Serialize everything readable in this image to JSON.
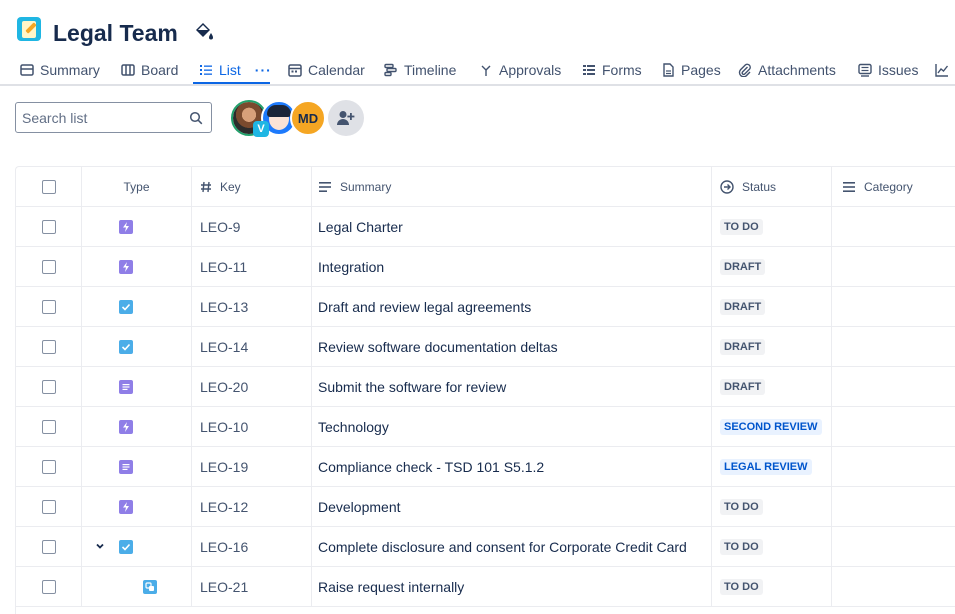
{
  "project": {
    "title": "Legal Team",
    "icon": "notepad-pencil-icon"
  },
  "tabs": [
    {
      "label": "Summary",
      "icon": "summary-icon"
    },
    {
      "label": "Board",
      "icon": "board-icon"
    },
    {
      "label": "List",
      "icon": "list-icon",
      "active": true
    },
    {
      "label": "Calendar",
      "icon": "calendar-icon"
    },
    {
      "label": "Timeline",
      "icon": "timeline-icon"
    },
    {
      "label": "Approvals",
      "icon": "approvals-icon"
    },
    {
      "label": "Forms",
      "icon": "forms-icon"
    },
    {
      "label": "Pages",
      "icon": "pages-icon"
    },
    {
      "label": "Attachments",
      "icon": "attachment-icon"
    },
    {
      "label": "Issues",
      "icon": "issues-icon"
    }
  ],
  "search": {
    "placeholder": "Search list"
  },
  "avatars": [
    {
      "initials": "",
      "badge": "V"
    },
    {
      "initials": ""
    },
    {
      "initials": "MD"
    }
  ],
  "columns": {
    "type": "Type",
    "key": "Key",
    "summary": "Summary",
    "status": "Status",
    "category": "Category"
  },
  "rows": [
    {
      "type": "epic",
      "key": "LEO-9",
      "summary": "Legal Charter",
      "status": "TO DO",
      "status_color": "grey"
    },
    {
      "type": "epic",
      "key": "LEO-11",
      "summary": "Integration",
      "status": "DRAFT",
      "status_color": "grey"
    },
    {
      "type": "task",
      "key": "LEO-13",
      "summary": "Draft and review legal agreements",
      "status": "DRAFT",
      "status_color": "grey"
    },
    {
      "type": "task",
      "key": "LEO-14",
      "summary": "Review software documentation deltas",
      "status": "DRAFT",
      "status_color": "grey"
    },
    {
      "type": "story",
      "key": "LEO-20",
      "summary": "Submit the software for review",
      "status": "DRAFT",
      "status_color": "grey"
    },
    {
      "type": "epic",
      "key": "LEO-10",
      "summary": "Technology",
      "status": "SECOND REVIEW",
      "status_color": "blue"
    },
    {
      "type": "story",
      "key": "LEO-19",
      "summary": "Compliance check - TSD 101 S5.1.2",
      "status": "LEGAL REVIEW",
      "status_color": "blue"
    },
    {
      "type": "epic",
      "key": "LEO-12",
      "summary": "Development",
      "status": "TO DO",
      "status_color": "grey"
    },
    {
      "type": "task",
      "key": "LEO-16",
      "summary": "Complete disclosure and consent for Corporate Credit Card",
      "status": "TO DO",
      "status_color": "grey",
      "expanded": true
    },
    {
      "type": "subtask",
      "key": "LEO-21",
      "summary": "Raise request internally",
      "status": "TO DO",
      "status_color": "grey"
    }
  ]
}
